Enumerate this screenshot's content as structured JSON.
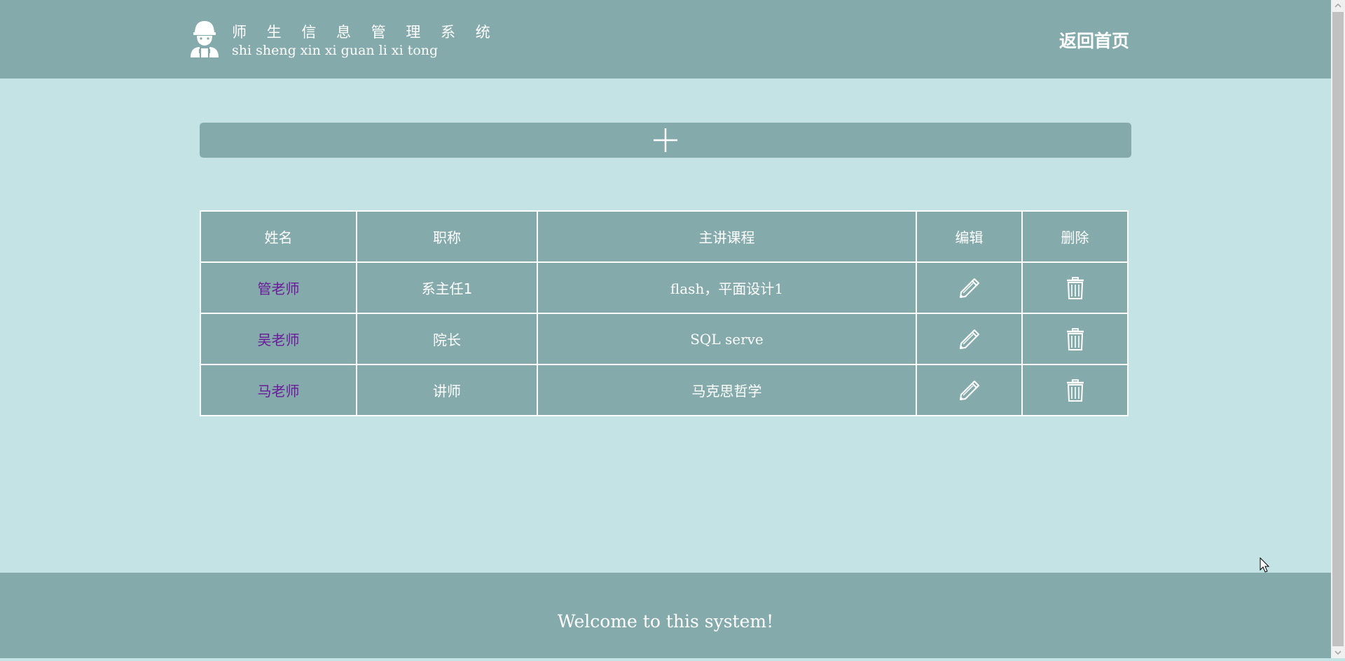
{
  "header": {
    "title_cn": "师 生 信 息 管 理 系 统",
    "title_pinyin": "shi sheng xin xi guan li xi tong",
    "home_link": "返回首页",
    "logo_icon": "worker-avatar-icon"
  },
  "add_bar": {
    "icon": "plus-icon"
  },
  "table": {
    "headers": [
      "姓名",
      "职称",
      "主讲课程",
      "编辑",
      "删除"
    ],
    "rows": [
      {
        "name": "管老师",
        "title": "系主任1",
        "course": "flash，平面设计1"
      },
      {
        "name": "吴老师",
        "title": "院长",
        "course": "SQL serve"
      },
      {
        "name": "马老师",
        "title": "讲师",
        "course": "马克思哲学"
      }
    ],
    "edit_icon": "pencil-icon",
    "delete_icon": "trash-icon"
  },
  "footer": {
    "text": "Welcome to this system!"
  },
  "colors": {
    "bar": "#85aaab",
    "background": "#c4e3e5",
    "link": "#6a1b9a",
    "text": "#ffffff"
  }
}
